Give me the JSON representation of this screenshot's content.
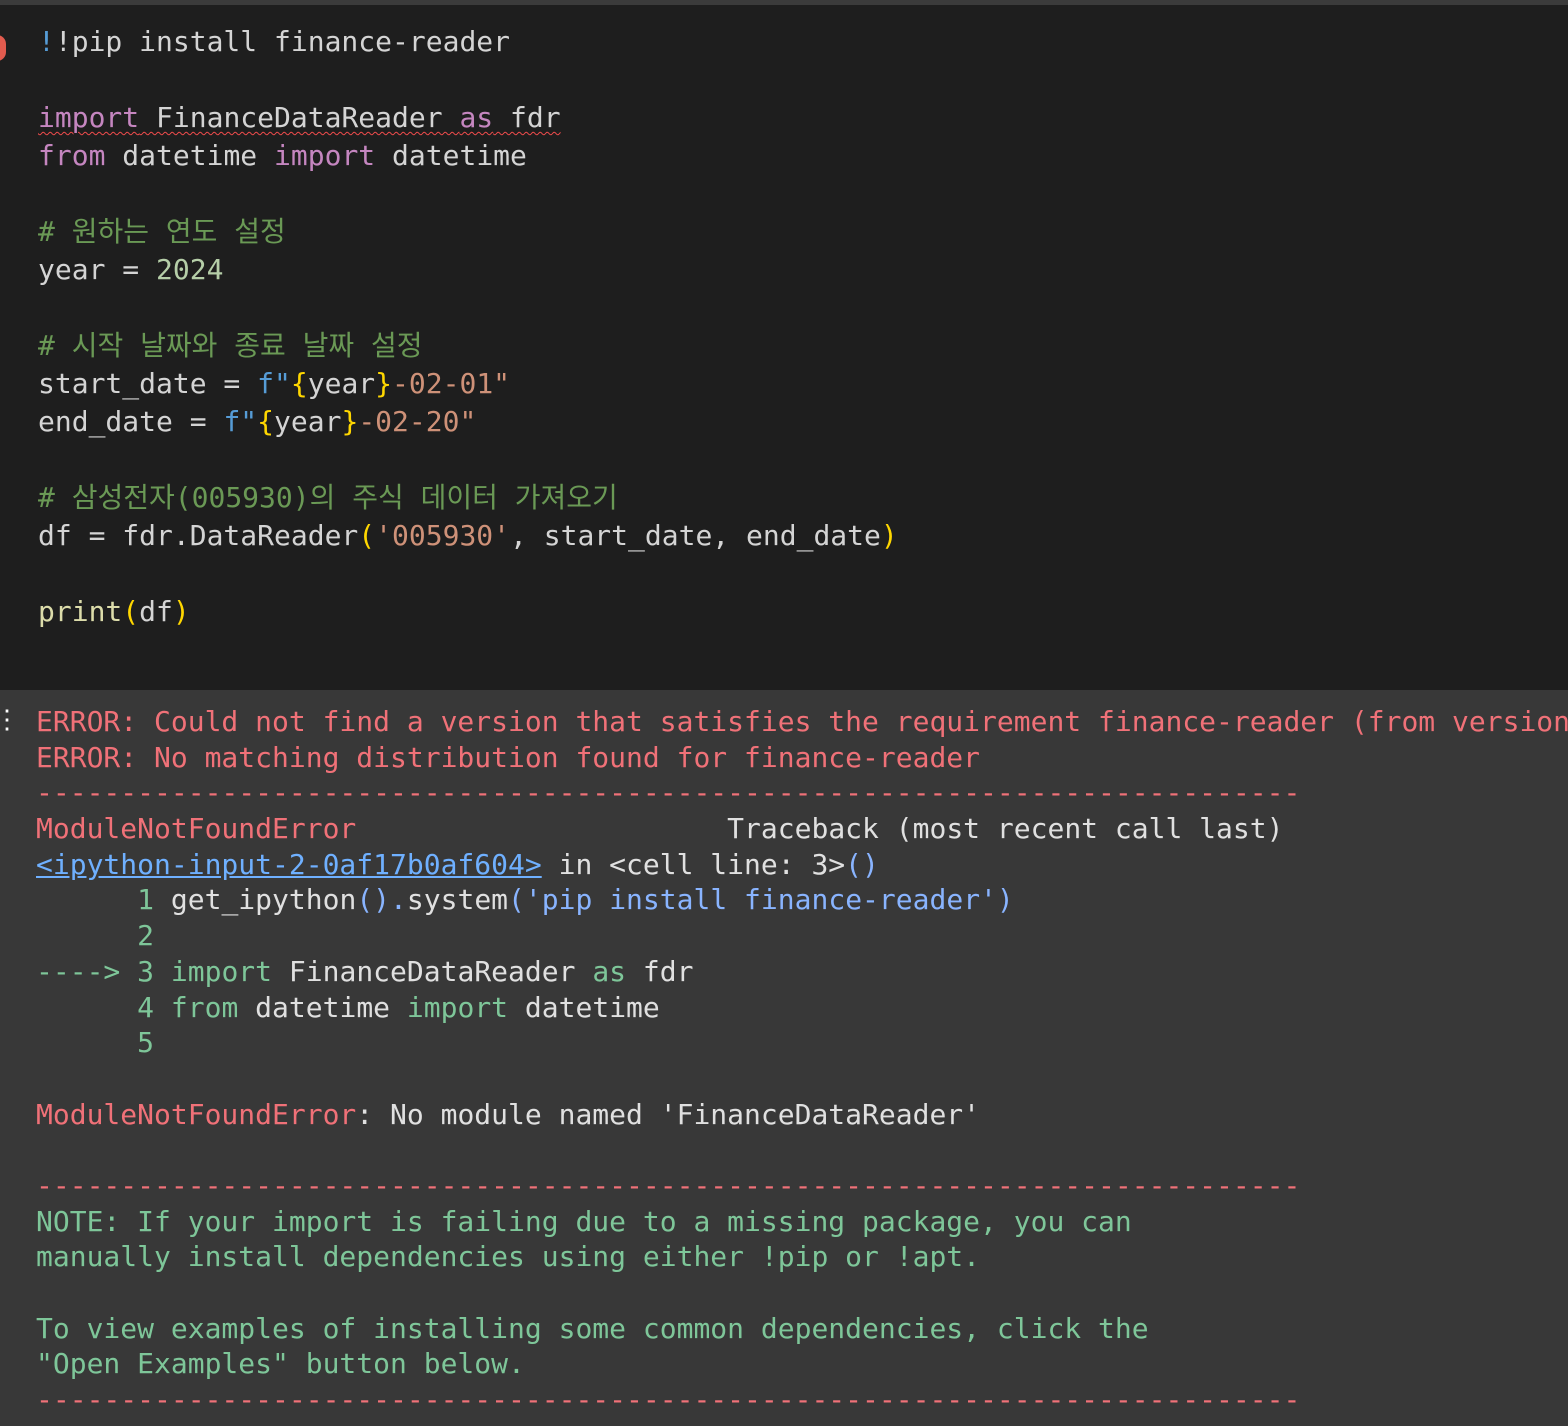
{
  "code_cell": {
    "line1": "!pip install finance-reader",
    "import_kw1": "import",
    "import_mod": " FinanceDataReader ",
    "as_kw": "as",
    "alias": " fdr",
    "from_kw": "from",
    "from_mod": " datetime ",
    "import_kw2": "import",
    "from_name": " datetime",
    "comment1": "# 원하는 연도 설정",
    "year_lhs": "year = ",
    "year_val": "2024",
    "comment2": "# 시작 날짜와 종료 날짜 설정",
    "start_lhs": "start_date = ",
    "end_lhs": "end_date = ",
    "f_prefix": "f\"",
    "brace_open": "{",
    "year_var": "year",
    "brace_close": "}",
    "start_tail": "-02-01\"",
    "end_tail": "-02-20\"",
    "comment3": "# 삼성전자(005930)의 주식 데이터 가져오기",
    "df_lhs": "df = fdr.DataReader",
    "paren_open": "(",
    "ticker": "'005930'",
    "df_args": ", start_date, end_date",
    "paren_close": ")",
    "print_fn": "print",
    "print_arg": "df"
  },
  "output": {
    "err1": "ERROR: Could not find a version that satisfies the requirement finance-reader (from versions: none)",
    "err2": "ERROR: No matching distribution found for finance-reader",
    "separator": "---------------------------------------------------------------------------",
    "exc_name": "ModuleNotFoundError",
    "traceback_label": "Traceback (most recent call last)",
    "input_link": "<ipython-input-2-0af17b0af604>",
    "in_cell": " in <cell line: 3>",
    "in_cell_parens": "()",
    "tb_lines": [
      {
        "marker": "      ",
        "num": "1",
        "content_a": " get_ipython",
        "content_b": "().",
        "content_c": "system",
        "content_d": "('pip install finance-reader')"
      },
      {
        "marker": "      ",
        "num": "2"
      },
      {
        "marker": "----> ",
        "num": "3",
        "kw1": " import",
        "mid": " FinanceDataReader ",
        "kw2": "as",
        "tail": " fdr"
      },
      {
        "marker": "      ",
        "num": "4",
        "kw1": " from",
        "mid": " datetime ",
        "kw2": "import",
        "tail": " datetime"
      },
      {
        "marker": "      ",
        "num": "5"
      }
    ],
    "final_error_name": "ModuleNotFoundError",
    "final_error_msg": ": No module named 'FinanceDataReader'",
    "note_lines": [
      "NOTE: If your import is failing due to a missing package, you can",
      "manually install dependencies using either !pip or !apt.",
      "",
      "To view examples of installing some common dependencies, click the",
      "\"Open Examples\" button below."
    ]
  },
  "colors": {
    "editor_bg": "#1e1e1e",
    "output_bg": "#383838",
    "error": "#f07178",
    "note": "#7ec699",
    "link": "#6fb0ff"
  }
}
